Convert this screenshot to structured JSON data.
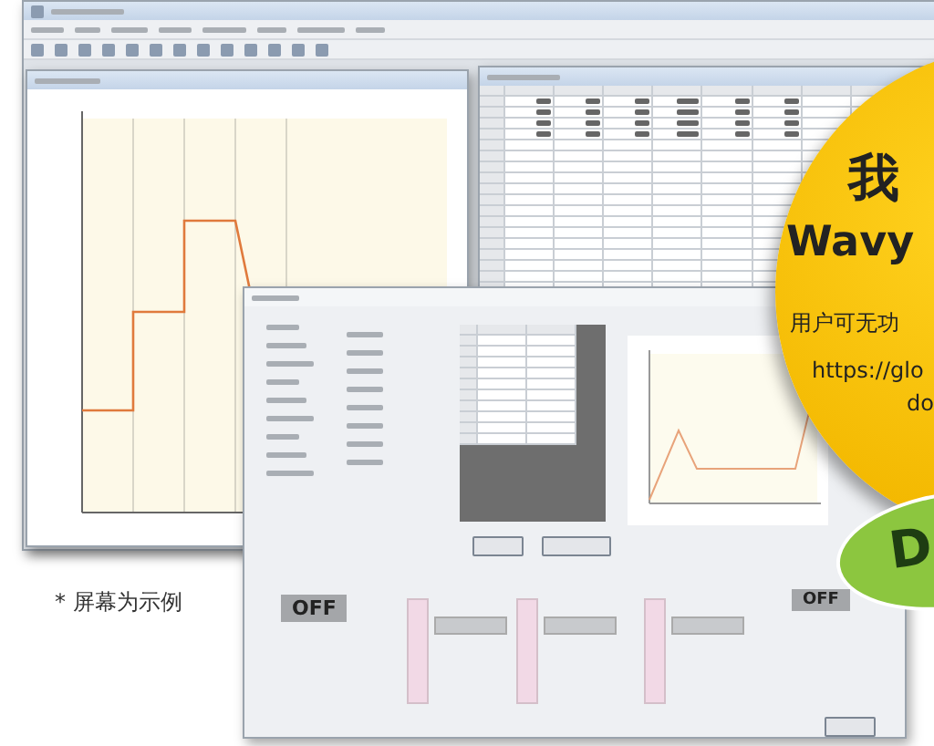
{
  "dialog": {
    "output_display": "OFF",
    "status_display": "OFF"
  },
  "promo": {
    "headline": "我",
    "brand": "Wavy",
    "subtitle": "用户可无功",
    "url_line_1": "https://glo",
    "url_line_2": "do",
    "badge": "D"
  },
  "caption": "* 屏幕为示例"
}
